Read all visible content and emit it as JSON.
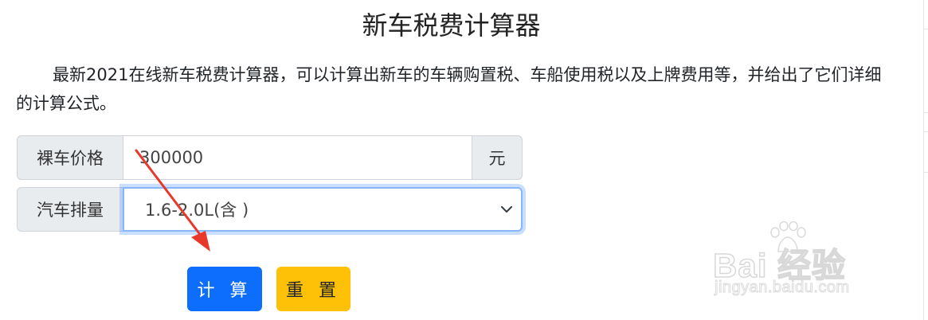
{
  "header": {
    "title": "新车税费计算器"
  },
  "intro": {
    "text": "最新2021在线新车税费计算器，可以计算出新车的车辆购置税、车船使用税以及上牌费用等，并给出了它们详细的计算公式。"
  },
  "form": {
    "price_label": "裸车价格",
    "price_value": "300000",
    "price_unit": "元",
    "displacement_label": "汽车排量",
    "displacement_selected": "1.6-2.0L(含 )"
  },
  "buttons": {
    "calc_label": "计 算",
    "reset_label": "重 置"
  },
  "watermark": {
    "logo_text": "Bai  经验",
    "url_text": "jingyan.baidu.com"
  },
  "colors": {
    "primary": "#0d6efd",
    "warning": "#ffc107",
    "annotation_arrow": "#e8382b"
  }
}
